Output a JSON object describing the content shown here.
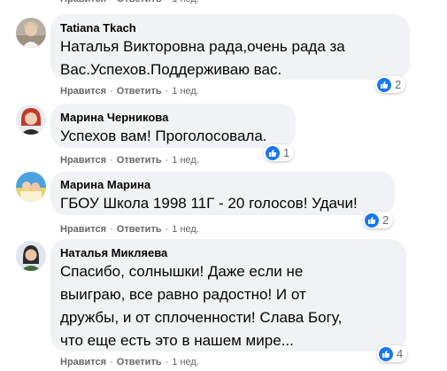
{
  "actions": {
    "like": "Нравится",
    "reply": "Ответить",
    "separator": "·",
    "time": "1 нед."
  },
  "comments": [
    {
      "author": "Tatiana Tkach",
      "lines": [
        "Наталья Викторовна рада,очень рада за",
        "Вас.Успехов.Поддерживаю вас."
      ],
      "reactions": "2"
    },
    {
      "author": "Марина Черникова",
      "lines": [
        "Успехов вам! Проголосовала."
      ],
      "reactions": "1"
    },
    {
      "author": "Марина Марина",
      "lines": [
        "ГБОУ Школа 1998 11Г - 20 голосов! Удачи!"
      ],
      "reactions": "2"
    },
    {
      "author": "Наталья Микляева",
      "lines": [
        "Спасибо, солнышки! Даже если не",
        "выиграю, все равно радостно! И от",
        "дружбы, и от сплоченности! Слава Богу,",
        "что еще есть это в нашем мире..."
      ],
      "reactions": "4"
    }
  ],
  "icons": {
    "reaction": "like-thumb-icon",
    "avatar": "avatar-photo"
  },
  "colors": {
    "bubble": "#f0f2f5",
    "like_blue": "#1877f2",
    "meta_text": "#65676b"
  }
}
